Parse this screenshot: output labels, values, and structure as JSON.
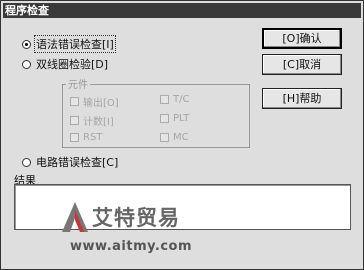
{
  "window": {
    "title": "程序检查"
  },
  "options": [
    {
      "label": "语法错误检查[I]",
      "selected": true
    },
    {
      "label": "双线圈检验[D]",
      "selected": false
    },
    {
      "label": "电路错误检查[C]",
      "selected": false
    }
  ],
  "group": {
    "title": "元件",
    "items": [
      "输出[O]",
      "T/C",
      "计数[I]",
      "PLT",
      "RST",
      "MC"
    ]
  },
  "buttons": {
    "ok": "[O]确认",
    "cancel": "[C]取消",
    "help": "[H]帮助"
  },
  "result": {
    "label": "结果",
    "value": ""
  },
  "watermark": {
    "brand": "艾特贸易",
    "url": "www.aitmy.com"
  }
}
